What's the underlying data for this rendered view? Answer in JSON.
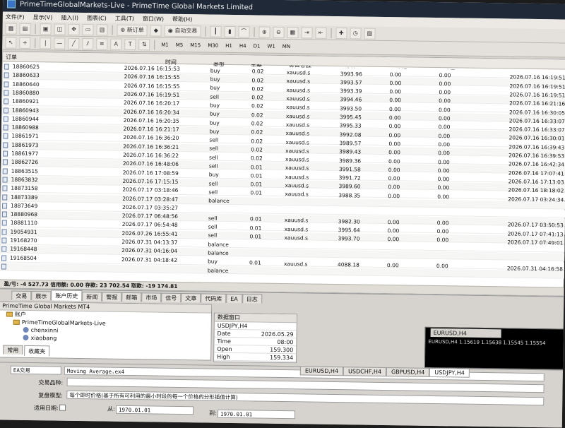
{
  "window": {
    "title": "PrimeTimeGlobalMarkets-Live - PrimeTime Global Markets Limited"
  },
  "menu": [
    "文件(F)",
    "显示(V)",
    "插入(I)",
    "图表(C)",
    "工具(T)",
    "窗口(W)",
    "帮助(H)"
  ],
  "toolbar": {
    "new_order": "新订单",
    "auto_trade": "自动交易",
    "timeframes": [
      "M1",
      "M5",
      "M15",
      "M30",
      "H1",
      "H4",
      "D1",
      "W1",
      "MN"
    ],
    "text_A": "A",
    "text_T": "T"
  },
  "orders": {
    "header_label": "订单",
    "columns": {
      "time": "时间",
      "type": "类型",
      "lots": "手数",
      "symbol": "交易品种",
      "price": "价格",
      "sl": "止损",
      "tp": "止盈",
      "close_time": "时间"
    },
    "rows": [
      {
        "id": "18860625",
        "time": "2026.07.16 16:15:53",
        "type": "buy",
        "lots": "0.02",
        "symbol": "xauusd.s",
        "price": "3993.96",
        "sl": "0.00",
        "tp": "0.00",
        "ctime": "2026.07.16 16:19:51"
      },
      {
        "id": "18860633",
        "time": "2026.07.16 16:15:55",
        "type": "buy",
        "lots": "0.02",
        "symbol": "xauusd.s",
        "price": "3993.57",
        "sl": "0.00",
        "tp": "0.00",
        "ctime": "2026.07.16 16:19:51"
      },
      {
        "id": "18860640",
        "time": "2026.07.16 16:15:55",
        "type": "buy",
        "lots": "0.02",
        "symbol": "xauusd.s",
        "price": "3993.39",
        "sl": "0.00",
        "tp": "0.00",
        "ctime": "2026.07.16 16:19:51"
      },
      {
        "id": "18860880",
        "time": "2026.07.16 16:19:51",
        "type": "sell",
        "lots": "0.02",
        "symbol": "xauusd.s",
        "price": "3994.46",
        "sl": "0.00",
        "tp": "0.00",
        "ctime": "2026.07.16 16:21:16"
      },
      {
        "id": "18860921",
        "time": "2026.07.16 16:20:17",
        "type": "buy",
        "lots": "0.02",
        "symbol": "xauusd.s",
        "price": "3993.50",
        "sl": "0.00",
        "tp": "0.00",
        "ctime": "2026.07.16 16:30:05"
      },
      {
        "id": "18860943",
        "time": "2026.07.16 16:20:34",
        "type": "buy",
        "lots": "0.02",
        "symbol": "xauusd.s",
        "price": "3995.45",
        "sl": "0.00",
        "tp": "0.00",
        "ctime": "2026.07.16 16:33:07"
      },
      {
        "id": "18860944",
        "time": "2026.07.16 16:20:35",
        "type": "buy",
        "lots": "0.02",
        "symbol": "xauusd.s",
        "price": "3995.33",
        "sl": "0.00",
        "tp": "0.00",
        "ctime": "2026.07.16 16:33:07"
      },
      {
        "id": "18860988",
        "time": "2026.07.16 16:21:17",
        "type": "buy",
        "lots": "0.02",
        "symbol": "xauusd.s",
        "price": "3992.08",
        "sl": "0.00",
        "tp": "0.00",
        "ctime": "2026.07.16 16:30:01"
      },
      {
        "id": "18861971",
        "time": "2026.07.16 16:36:20",
        "type": "sell",
        "lots": "0.02",
        "symbol": "xauusd.s",
        "price": "3989.57",
        "sl": "0.00",
        "tp": "0.00",
        "ctime": "2026.07.16 16:39:43"
      },
      {
        "id": "18861973",
        "time": "2026.07.16 16:36:21",
        "type": "sell",
        "lots": "0.02",
        "symbol": "xauusd.s",
        "price": "3989.43",
        "sl": "0.00",
        "tp": "0.00",
        "ctime": "2026.07.16 16:39:53"
      },
      {
        "id": "18861977",
        "time": "2026.07.16 16:36:22",
        "type": "sell",
        "lots": "0.02",
        "symbol": "xauusd.s",
        "price": "3989.36",
        "sl": "0.00",
        "tp": "0.00",
        "ctime": "2026.07.16 16:42:34"
      },
      {
        "id": "18862726",
        "time": "2026.07.16 16:48:06",
        "type": "sell",
        "lots": "0.01",
        "symbol": "xauusd.s",
        "price": "3991.58",
        "sl": "0.00",
        "tp": "0.00",
        "ctime": "2026.07.16 17:07:41"
      },
      {
        "id": "18863515",
        "time": "2026.07.16 17:08:59",
        "type": "buy",
        "lots": "0.01",
        "symbol": "xauusd.s",
        "price": "3991.72",
        "sl": "0.00",
        "tp": "0.00",
        "ctime": "2026.07.16 17:13:03"
      },
      {
        "id": "18863832",
        "time": "2026.07.16 17:15:15",
        "type": "sell",
        "lots": "0.01",
        "symbol": "xauusd.s",
        "price": "3989.60",
        "sl": "0.00",
        "tp": "0.00",
        "ctime": "2026.07.16 18:18:02"
      },
      {
        "id": "18873158",
        "time": "2026.07.17 03:18:46",
        "type": "sell",
        "lots": "0.01",
        "symbol": "xauusd.s",
        "price": "3988.35",
        "sl": "0.00",
        "tp": "0.00",
        "ctime": "2026.07.17 03:24:34"
      },
      {
        "id": "18873389",
        "time": "2026.07.17 03:28:47",
        "type": "balance",
        "lots": "",
        "symbol": "",
        "price": "",
        "sl": "",
        "tp": "",
        "ctime": ""
      },
      {
        "id": "18873649",
        "time": "2026.07.17 03:35:27",
        "type": "",
        "lots": "",
        "symbol": "",
        "price": "",
        "sl": "",
        "tp": "",
        "ctime": ""
      },
      {
        "id": "18880968",
        "time": "2026.07.17 06:48:56",
        "type": "sell",
        "lots": "0.01",
        "symbol": "xauusd.s",
        "price": "3982.30",
        "sl": "0.00",
        "tp": "0.00",
        "ctime": "2026.07.17 03:50:53"
      },
      {
        "id": "18881110",
        "time": "2026.07.17 06:54:48",
        "type": "sell",
        "lots": "0.01",
        "symbol": "xauusd.s",
        "price": "3995.64",
        "sl": "0.00",
        "tp": "0.00",
        "ctime": "2026.07.17 07:41:13"
      },
      {
        "id": "19054931",
        "time": "2026.07.26 16:55:41",
        "type": "sell",
        "lots": "0.01",
        "symbol": "xauusd.s",
        "price": "3993.70",
        "sl": "0.00",
        "tp": "0.00",
        "ctime": "2026.07.17 07:49:01"
      },
      {
        "id": "19168270",
        "time": "2026.07.31 04:13:37",
        "type": "balance",
        "lots": "",
        "symbol": "",
        "price": "",
        "sl": "",
        "tp": "",
        "ctime": ""
      },
      {
        "id": "19168448",
        "time": "2026.07.31 04:16:04",
        "type": "balance",
        "lots": "",
        "symbol": "",
        "price": "",
        "sl": "",
        "tp": "",
        "ctime": ""
      },
      {
        "id": "19168504",
        "time": "2026.07.31 04:18:42",
        "type": "buy",
        "lots": "0.01",
        "symbol": "xauusd.s",
        "price": "4088.18",
        "sl": "0.00",
        "tp": "0.00",
        "ctime": "2026.07.31 04:16:58"
      },
      {
        "id": "",
        "time": "",
        "type": "balance",
        "lots": "",
        "symbol": "",
        "price": "",
        "sl": "",
        "tp": "",
        "ctime": ""
      }
    ],
    "summary": "盈/亏: -4 527.73  信用额: 0.00  存款: 23 702.54  取款: -19 174.81"
  },
  "terminal_tabs": [
    "交易",
    "展示",
    "账户历史",
    "新闻",
    "警报",
    "邮箱",
    "市场",
    "信号",
    "文章",
    "代码库",
    "EA",
    "日志"
  ],
  "terminal_active_tab": "账户历史",
  "navigator": {
    "title": "PrimeTime Global Markets MT4",
    "accounts_label": "账户",
    "server": "PrimeTimeGlobalMarkets-Live",
    "user1": "chenxinni",
    "user2": "xiaobang",
    "tabs": [
      "常用",
      "收藏夹"
    ]
  },
  "data_window": {
    "title": "数据窗口",
    "symbol": "USDJPY,H4",
    "rows": [
      {
        "label": "Date",
        "value": "2026.05.29"
      },
      {
        "label": "Time",
        "value": "08:00"
      },
      {
        "label": "Open",
        "value": "159.300"
      },
      {
        "label": "High",
        "value": "159.334"
      }
    ]
  },
  "chart_tabs": [
    "EURUSD,H4",
    "USDCHF,H4",
    "GBPUSD,H4",
    "USDJPY,H4"
  ],
  "chart_active": "USDJPY,H4",
  "chart_window": {
    "caption": "EURUSD,H4",
    "ohlc": "EURUSD,H4  1.15619 1.15638 1.15545 1.15554"
  },
  "tester": {
    "ea_label": "EA交易",
    "ea_value": "Moving Average.ex4",
    "symbol_label": "交易品种:",
    "model_label": "复盘模型:",
    "model_value": "每个即时价格(基于所有可利用的最小时段的每一个价格的分形插值计算)",
    "date_label": "适用日期:",
    "from_label": "从:",
    "from_value": "1970.01.01",
    "to_label": "到:",
    "to_value": "1970.01.01"
  },
  "colors": {
    "titlebar": "#1f2937",
    "chrome": "#d6d3ce",
    "grid": "#ffffff"
  }
}
